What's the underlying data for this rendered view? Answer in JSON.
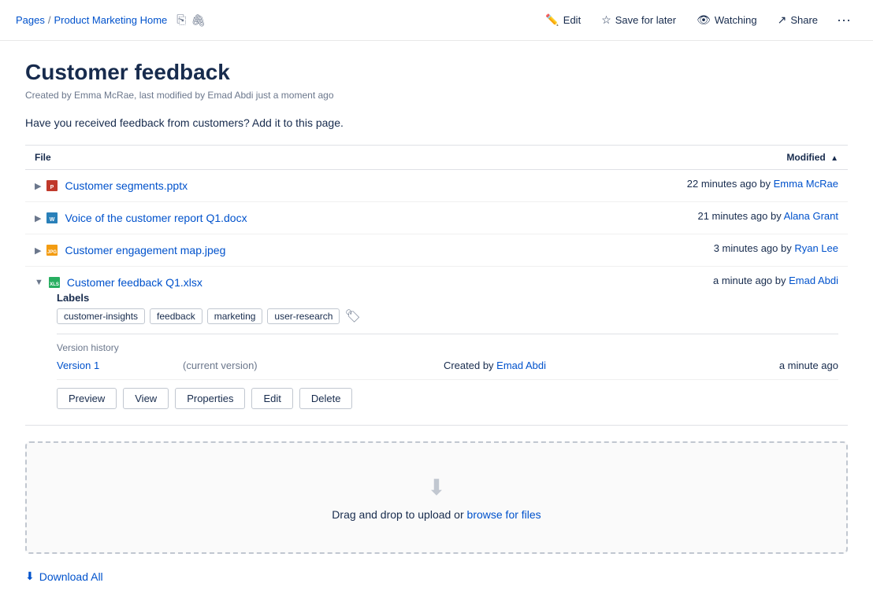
{
  "breadcrumb": {
    "pages_label": "Pages",
    "separator": "/",
    "current_page": "Product Marketing Home"
  },
  "nav_actions": {
    "edit_label": "Edit",
    "save_label": "Save for later",
    "watching_label": "Watching",
    "share_label": "Share"
  },
  "page": {
    "title": "Customer feedback",
    "meta": "Created by Emma McRae, last modified by Emad Abdi just a moment ago",
    "description": "Have you received feedback from customers? Add it to this page."
  },
  "table": {
    "col_file": "File",
    "col_modified": "Modified"
  },
  "files": [
    {
      "id": "file-1",
      "name": "Customer segments.pptx",
      "icon": "pptx",
      "modified_text": "22 minutes ago by ",
      "modified_by": "Emma McRae",
      "expanded": false
    },
    {
      "id": "file-2",
      "name": "Voice of the customer report Q1.docx",
      "icon": "docx",
      "modified_text": "21 minutes ago by ",
      "modified_by": "Alana Grant",
      "expanded": false
    },
    {
      "id": "file-3",
      "name": "Customer engagement map.jpeg",
      "icon": "jpeg",
      "modified_text": "3 minutes ago by ",
      "modified_by": "Ryan Lee",
      "expanded": false
    },
    {
      "id": "file-4",
      "name": "Customer feedback Q1.xlsx",
      "icon": "xlsx",
      "modified_text": "a minute ago by ",
      "modified_by": "Emad Abdi",
      "expanded": true
    }
  ],
  "expanded_file": {
    "labels_title": "Labels",
    "labels": [
      "customer-insights",
      "feedback",
      "marketing",
      "user-research"
    ],
    "version_history_title": "Version history",
    "version": {
      "name": "Version 1",
      "current_label": "(current version)",
      "created_prefix": "Created by",
      "created_by": "Emad Abdi",
      "time": "a minute ago"
    },
    "actions": [
      "Preview",
      "View",
      "Properties",
      "Edit",
      "Delete"
    ]
  },
  "upload": {
    "arrow": "⬇",
    "text": "Drag and drop to upload or ",
    "browse_label": "browse for files"
  },
  "download_all": {
    "label": "Download All",
    "icon": "⬇"
  }
}
